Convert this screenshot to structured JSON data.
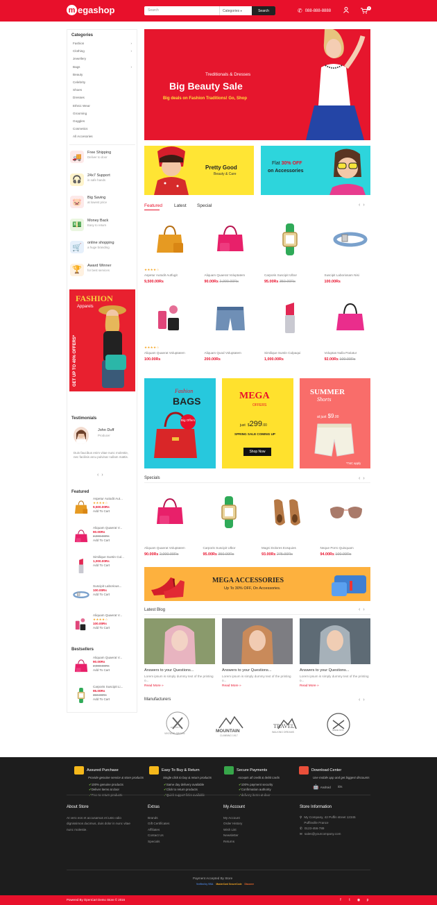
{
  "header": {
    "logo_letter": "m",
    "logo_text": "egashop",
    "search_placeholder": "Search",
    "category_select": "Categories",
    "search_button": "Search",
    "phone": "088-888-8888",
    "cart_count": "0",
    "accent": "#e8102b"
  },
  "sidebar": {
    "categories_title": "Categories",
    "categories": [
      "Fashion",
      "Clothing",
      "Jewellery",
      "Bags",
      "Beauty",
      "Celebrity",
      "Shoes",
      "Dresses",
      "Ethnic Wear",
      "Grooming",
      "Goggles",
      "Cosmetics",
      "All Accesories"
    ],
    "features": [
      {
        "title": "Free Shipping",
        "sub": "Deliver to door",
        "icon": "truck-icon"
      },
      {
        "title": "24x7 Support",
        "sub": "in safe hands",
        "icon": "headset-icon"
      },
      {
        "title": "Big Saving",
        "sub": "at lowest price",
        "icon": "piggy-bank-icon"
      },
      {
        "title": "Money Back",
        "sub": "Easy to return",
        "icon": "money-icon"
      },
      {
        "title": "online shopping",
        "sub": "a huge branding",
        "icon": "cart-icon"
      },
      {
        "title": "Award Winner",
        "sub": "for best services",
        "icon": "award-icon"
      }
    ],
    "side_banner": {
      "title": "FASHION",
      "subtitle": "Apparels",
      "offer": "GET UP TO 40% OFFERS*"
    },
    "testimonials_title": "Testimonials",
    "testimonial": {
      "name": "John Duff",
      "role": "Producer",
      "text": "Duis faucibus enim vitae nunc molestie, nec facilisis arcu pulvinar nullam mattis."
    },
    "featured_title": "Featured",
    "featured": [
      {
        "name": "Aspetur Autodit Aut...",
        "price": "9,500.00Rs",
        "old": "",
        "cta": "Add To Cart",
        "stars": "★★★★☆"
      },
      {
        "name": "Aliquam Quaerat V...",
        "price": "90.00Rs",
        "old": "2,000.00Rs",
        "cta": "Add To Cart",
        "stars": ""
      },
      {
        "name": "Similique Suntin Cul...",
        "price": "1,000.00Rs",
        "old": "",
        "cta": "Add To Cart",
        "stars": ""
      },
      {
        "name": "Suscipit Laborious...",
        "price": "100.00Rs",
        "old": "",
        "cta": "Add To Cart",
        "stars": ""
      },
      {
        "name": "Aliquam Quaerat V...",
        "price": "100.00Rs",
        "old": "",
        "cta": "Add To Cart",
        "stars": "★★★★☆"
      }
    ],
    "bestsellers_title": "Bestsellers",
    "bestsellers": [
      {
        "name": "Aliquam Quaerat V...",
        "price": "90.00Rs",
        "old": "2,000.00Rs",
        "cta": "Add To Cart"
      },
      {
        "name": "Carporis Suscipit Li...",
        "price": "95.00Rs",
        "old": "350.00Rs",
        "cta": "Add To Cart"
      }
    ]
  },
  "hero": {
    "kicker": "Treditionals & Dresses",
    "title": "Big Beauty Sale",
    "sub": "Big deals on Fashion Traditions! Go, Shop"
  },
  "small_banners": [
    {
      "title": "Pretty Good",
      "sub": "Beauty & Care"
    },
    {
      "line1": "Flat",
      "pct": "30% OFF",
      "line2": "on Accessories"
    }
  ],
  "tabs": [
    "Featured",
    "Latest",
    "Special"
  ],
  "products": [
    {
      "name": "Aspetur Autodit Autfugit",
      "price": "9,500.00Rs",
      "old": "",
      "stars": "★★★★☆",
      "icon": "handbag-orange-icon"
    },
    {
      "name": "Aliquam Quaerat Voluptatem",
      "price": "90.00Rs",
      "old": "2,000.00Rs",
      "stars": "",
      "icon": "handbag-pink-icon"
    },
    {
      "name": "Carporis Suscipit Ulbor",
      "price": "95.00Rs",
      "old": "350.00Rs",
      "stars": "",
      "icon": "watch-icon"
    },
    {
      "name": "Suscipit Laboriosam Nisi",
      "price": "100.00Rs",
      "old": "",
      "stars": "",
      "icon": "belt-icon"
    },
    {
      "name": "Aliquam Quaerat Voluptatem",
      "price": "100.00Rs",
      "old": "",
      "stars": "★★★★☆",
      "icon": "cosmetics-icon"
    },
    {
      "name": "Aliquam Quod Voluptatem",
      "price": "200.00Rs",
      "old": "",
      "stars": "",
      "icon": "shorts-icon"
    },
    {
      "name": "Similique Suntin Culpaqui",
      "price": "1,000.00Rs",
      "old": "",
      "stars": "",
      "icon": "lipstick-icon"
    },
    {
      "name": "Voluptas Nulla Pariatur",
      "price": "92.00Rs",
      "old": "100.00Rs",
      "stars": "",
      "icon": "handbag-magenta-icon"
    }
  ],
  "promos": {
    "bags": {
      "script": "Fashion",
      "title": "BAGS",
      "badge": "Big Offers"
    },
    "mega": {
      "title": "MEGA",
      "sub": "OFFERS",
      "just": "just",
      "price": "299",
      "cents": ".00",
      "spring": "SPRING SALE COMING UP",
      "button": "Shop Now"
    },
    "summer": {
      "title": "SUMMER",
      "script": "Shorts",
      "at": "at just",
      "price": "$9",
      "cents": ".00",
      "apply": "*T&C apply"
    }
  },
  "specials_title": "Specials",
  "specials": [
    {
      "name": "Aliquam Quaerat Voluptatem",
      "price": "90.00Rs",
      "old": "2,000.00Rs",
      "icon": "handbag-pink-icon"
    },
    {
      "name": "Carporis Suscipit Ulbor",
      "price": "95.00Rs",
      "old": "350.00Rs",
      "icon": "watch-icon"
    },
    {
      "name": "Magni Dolores Eosquies",
      "price": "93.00Rs",
      "old": "275.00Rs",
      "icon": "shoes-icon"
    },
    {
      "name": "Neque Porro Quisquam",
      "price": "94.00Rs",
      "old": "100.00Rs",
      "icon": "sunglasses-icon"
    }
  ],
  "accessories_banner": {
    "title": "MEGA ACCESSORIES",
    "sub": "Up To 30% OFF, On Accessories."
  },
  "blog_title": "Latest Blog",
  "blogs": [
    {
      "title": "Answers to your Questions...",
      "text": "Lorem ipsum is simply dummy text of the printing o...",
      "more": "Read More »"
    },
    {
      "title": "Answers to your Questions...",
      "text": "Lorem ipsum is simply dummy text of the printing o...",
      "more": "Read More »"
    },
    {
      "title": "Answers to your Questions...",
      "text": "Lorem ipsum is simply dummy text of the printing o...",
      "more": "Read More »"
    }
  ],
  "manufacturers_title": "Manufacturers",
  "manufacturers": [
    {
      "name": "VINTAGE SPOON",
      "year": "EST 2017"
    },
    {
      "name": "MOUNTAIN",
      "sub": "CLIMBING 1917"
    },
    {
      "name": "TRAVEL",
      "sub": "WALKING DREAMS"
    },
    {
      "name": "SINCE 1971"
    }
  ],
  "footer": {
    "services": [
      {
        "title": "Assured Purchase",
        "sub": "Provide genuine service & store products",
        "items": [
          "100% genuine products",
          "Deliver items at door",
          "Free to return products"
        ],
        "icon": "medal-icon"
      },
      {
        "title": "Easy To Buy & Return",
        "sub": "Single click to buy & return products",
        "items": [
          "Same day delivery available",
          "Click to return products",
          "Quick support links available"
        ],
        "icon": "delivery-icon"
      },
      {
        "title": "Secure Payments",
        "sub": "Accepts all credit & debit cards",
        "items": [
          "100% payment security",
          "Confirmation authority",
          "delivery items at door"
        ],
        "icon": "cash-icon"
      },
      {
        "title": "Download Center",
        "sub": "Use mobile app and get biggest discounts",
        "items": [],
        "icon": "mobile-icon",
        "android": "Android",
        "ios": "iOs"
      }
    ],
    "about_title": "About Store",
    "about_text": "At vero eos et accusamus et iusto odio dignissimos ducimus, duis dolor in nunc vitae nunc molestie.",
    "extras_title": "Extras",
    "extras": [
      "Brands",
      "Gift Certificates",
      "Affiliates",
      "Contact Us",
      "Specials"
    ],
    "account_title": "My Account",
    "account": [
      "My Account",
      "Order History",
      "Wish List",
      "Newsletter",
      "Returns"
    ],
    "info_title": "Store Information",
    "address": "My Company, 42 Puffin street 12345 Puffinville France",
    "phone": "0123-456-789",
    "email": "sales@yourcompany.com",
    "payment_title": "Payment Accepted By Store",
    "payment_logos": [
      "Verified by VISA",
      "MasterCard SecureCode",
      "Discover"
    ],
    "powered": "Powered By OpenCart Demo Store © 2016"
  }
}
